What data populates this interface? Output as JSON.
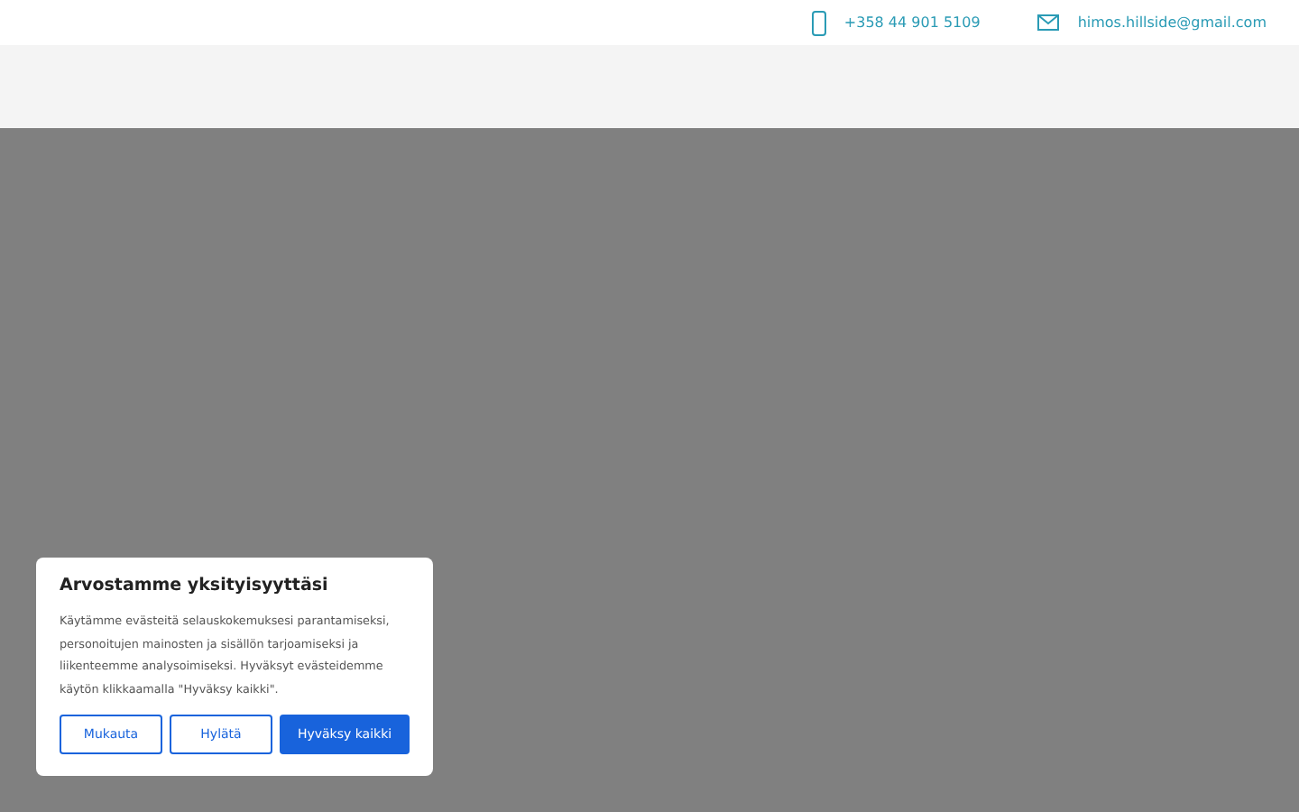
{
  "contact_bar": {
    "phone": "+358 44 901 5109",
    "email": "himos.hillside@gmail.com"
  },
  "cookie_notice": {
    "title": "Arvostamme yksityisyyttäsi",
    "text": "Käytämme evästeitä selauskokemuksesi parantamiseksi, personoitujen mainosten ja sisällön tarjoamiseksi ja liikenteemme analysoimiseksi. Hyväksyt evästeidemme käytön klikkaamalla \"Hyväksy kaikki\".",
    "buttons": [
      {
        "label": "Mukauta",
        "kind": "outline"
      },
      {
        "label": "Hylätä",
        "kind": "outline"
      },
      {
        "label": "Hyväksy kaikki",
        "kind": "primary"
      }
    ]
  }
}
